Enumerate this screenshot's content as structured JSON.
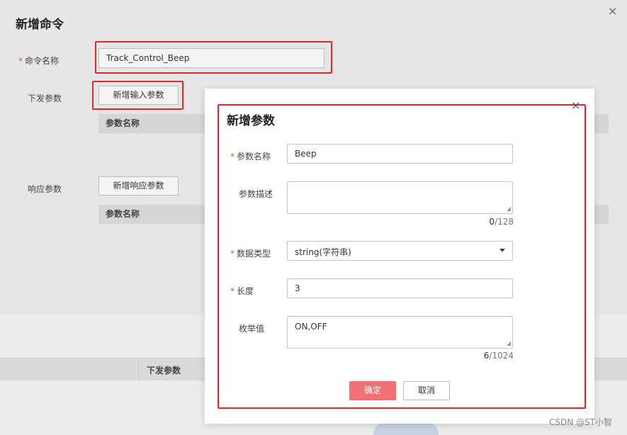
{
  "background": {
    "title": "新增命令",
    "command_name_label": "命令名称",
    "command_name_value": "Track_Control_Beep",
    "downlink_label": "下发参数",
    "add_input_button": "新增输入参数",
    "table1_header": "参数名称",
    "response_label": "响应参数",
    "add_response_button": "新增响应参数",
    "table2_header": "参数名称",
    "bottom_column": "下发参数",
    "close_symbol": "×"
  },
  "dialog": {
    "title": "新增参数",
    "close_symbol": "×",
    "param_name_label": "参数名称",
    "param_name_value": "Beep",
    "desc_label": "参数描述",
    "desc_value": "",
    "desc_counter_current": "0",
    "desc_counter_max": "/128",
    "type_label": "数据类型",
    "type_value": "string(字符串)",
    "length_label": "长度",
    "length_value": "3",
    "enum_label": "枚举值",
    "enum_value": "ON,OFF",
    "enum_counter_current": "6",
    "enum_counter_max": "/1024",
    "ok_button": "确定",
    "cancel_button": "取消"
  },
  "required_mark": "*",
  "watermark": "CSDN @ST小智",
  "colors": {
    "primary_button": "#f07173",
    "required": "#e04a3f",
    "highlight_box": "#e0282a"
  }
}
